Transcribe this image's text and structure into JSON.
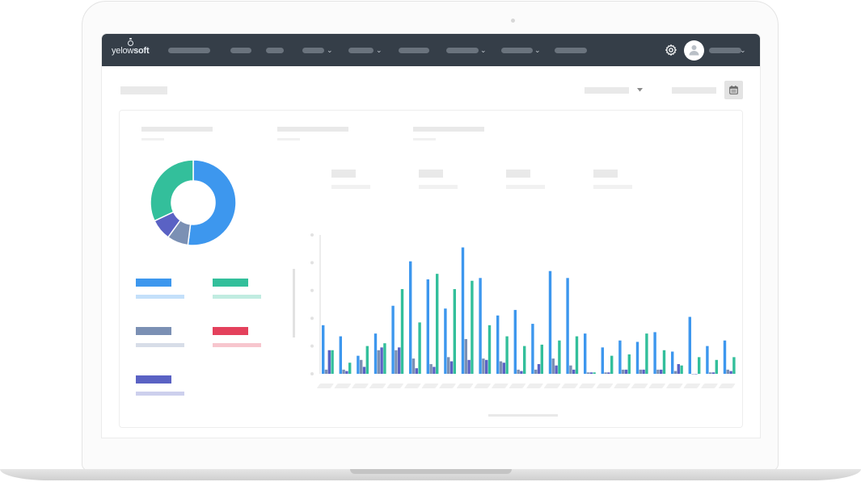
{
  "app": {
    "brand_light": "yelow",
    "brand_bold": "soft"
  },
  "navbar": {
    "items": [
      "",
      "",
      "",
      "",
      "",
      "",
      "",
      "",
      ""
    ],
    "user_name": ""
  },
  "colors": {
    "topbar": "#353e48",
    "blue": "#3d97ee",
    "green": "#33bf9b",
    "slate": "#7b90b4",
    "indigo": "#5a62c4",
    "red": "#e4415c"
  },
  "icons": [
    "gear-icon",
    "user-icon",
    "chevron-down-icon",
    "calendar-icon",
    "caret-down-icon"
  ],
  "legend": [
    {
      "series": "blue",
      "color": "#3d97ee"
    },
    {
      "series": "green",
      "color": "#33bf9b"
    },
    {
      "series": "slate",
      "color": "#7b90b4"
    },
    {
      "series": "red",
      "color": "#e4415c"
    },
    {
      "series": "indigo",
      "color": "#5a62c4"
    }
  ],
  "chart_data": [
    {
      "type": "pie",
      "title": "",
      "slices": [
        {
          "color": "#3d97ee",
          "value": 52
        },
        {
          "color": "#7b90b4",
          "value": 8
        },
        {
          "color": "#5a62c4",
          "value": 8
        },
        {
          "color": "#33bf9b",
          "value": 32
        }
      ]
    },
    {
      "type": "bar",
      "title": "",
      "xlabel": "",
      "ylabel": "",
      "ylim": [
        0,
        10
      ],
      "grid": false,
      "categories": [
        "",
        "",
        "",
        "",
        "",
        "",
        "",
        "",
        "",
        "",
        "",
        "",
        "",
        "",
        "",
        "",
        "",
        "",
        "",
        "",
        "",
        "",
        "",
        ""
      ],
      "series": [
        {
          "color": "#3d97ee",
          "values": [
            3.5,
            2.7,
            1.3,
            2.9,
            4.9,
            8.1,
            6.8,
            4.7,
            9.1,
            6.9,
            4.2,
            4.6,
            3.6,
            7.4,
            6.9,
            2.9,
            1.9,
            2.4,
            2.3,
            3.0,
            1.6,
            4.1,
            2.0,
            2.4
          ]
        },
        {
          "color": "#7b90b4",
          "values": [
            0.3,
            0.3,
            1.0,
            1.7,
            1.7,
            1.1,
            0.7,
            1.2,
            2.5,
            1.1,
            0.9,
            0.3,
            0.3,
            1.1,
            0.6,
            0.1,
            0.1,
            0.3,
            0.3,
            0.3,
            0.2,
            0.0,
            0.1,
            0.3
          ]
        },
        {
          "color": "#5a62c4",
          "values": [
            1.7,
            0.2,
            0.5,
            1.9,
            1.9,
            0.4,
            0.5,
            0.9,
            1.0,
            1.0,
            0.8,
            0.2,
            0.7,
            0.6,
            0.3,
            0.1,
            0.1,
            0.3,
            0.3,
            0.3,
            0.7,
            0.0,
            0.1,
            0.2
          ]
        },
        {
          "color": "#33bf9b",
          "values": [
            1.7,
            0.8,
            2.0,
            2.2,
            6.1,
            3.7,
            7.2,
            6.1,
            6.7,
            3.5,
            2.7,
            2.0,
            2.1,
            2.4,
            2.7,
            0.1,
            1.3,
            1.4,
            2.9,
            1.7,
            0.6,
            1.2,
            1.0,
            1.2
          ]
        }
      ]
    }
  ]
}
